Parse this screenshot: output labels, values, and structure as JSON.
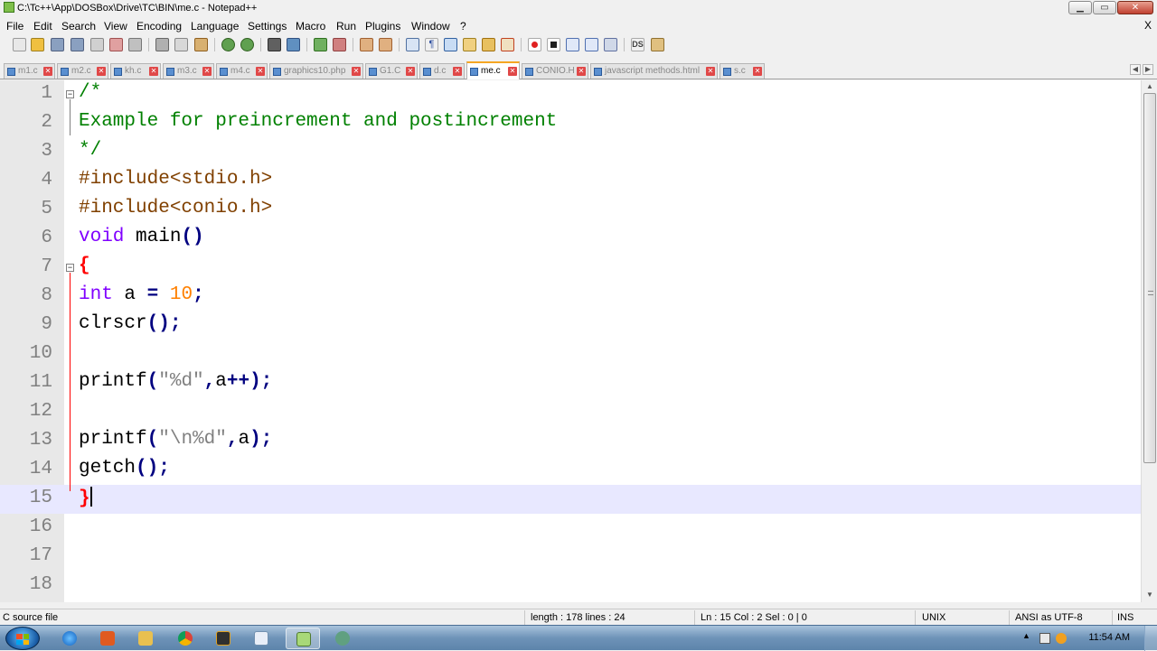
{
  "window": {
    "title": "C:\\Tc++\\App\\DOSBox\\Drive\\TC\\BIN\\me.c - Notepad++",
    "min_label": "▁",
    "max_label": "▭",
    "close_label": "✕"
  },
  "menu": {
    "items": [
      "File",
      "Edit",
      "Search",
      "View",
      "Encoding",
      "Language",
      "Settings",
      "Macro",
      "Run",
      "Plugins",
      "Window",
      "?"
    ],
    "close_label": "X"
  },
  "tabs": [
    {
      "label": "m1.c",
      "active": false
    },
    {
      "label": "m2.c",
      "active": false
    },
    {
      "label": "kh.c",
      "active": false
    },
    {
      "label": "m3.c",
      "active": false
    },
    {
      "label": "m4.c",
      "active": false
    },
    {
      "label": "graphics10.php",
      "active": false
    },
    {
      "label": "G1.C",
      "active": false
    },
    {
      "label": "d.c",
      "active": false
    },
    {
      "label": "me.c",
      "active": true
    },
    {
      "label": "CONIO.H",
      "active": false
    },
    {
      "label": "javascript methods.html",
      "active": false
    },
    {
      "label": "s.c",
      "active": false
    }
  ],
  "tab_close_label": "✕",
  "editor": {
    "current_line": 15,
    "lines": [
      {
        "n": "1",
        "tokens": [
          {
            "t": "/*",
            "c": "comment"
          }
        ]
      },
      {
        "n": "2",
        "tokens": [
          {
            "t": "Example for preincrement and postincrement",
            "c": "comment"
          }
        ]
      },
      {
        "n": "3",
        "tokens": [
          {
            "t": "*/",
            "c": "comment"
          }
        ]
      },
      {
        "n": "4",
        "tokens": [
          {
            "t": "#include<stdio.h>",
            "c": "pre"
          }
        ]
      },
      {
        "n": "5",
        "tokens": [
          {
            "t": "#include<conio.h>",
            "c": "pre"
          }
        ]
      },
      {
        "n": "6",
        "tokens": [
          {
            "t": "void",
            "c": "kw"
          },
          {
            "t": " main",
            "c": "plain"
          },
          {
            "t": "()",
            "c": "op"
          }
        ]
      },
      {
        "n": "7",
        "tokens": [
          {
            "t": "{",
            "c": "brace"
          }
        ]
      },
      {
        "n": "8",
        "tokens": [
          {
            "t": "int",
            "c": "kw"
          },
          {
            "t": " a ",
            "c": "plain"
          },
          {
            "t": "=",
            "c": "op"
          },
          {
            "t": " ",
            "c": "plain"
          },
          {
            "t": "10",
            "c": "num"
          },
          {
            "t": ";",
            "c": "op"
          }
        ]
      },
      {
        "n": "9",
        "tokens": [
          {
            "t": "clrscr",
            "c": "plain"
          },
          {
            "t": "();",
            "c": "op"
          }
        ]
      },
      {
        "n": "10",
        "tokens": []
      },
      {
        "n": "11",
        "tokens": [
          {
            "t": "printf",
            "c": "plain"
          },
          {
            "t": "(",
            "c": "op"
          },
          {
            "t": "\"%d\"",
            "c": "str"
          },
          {
            "t": ",",
            "c": "op"
          },
          {
            "t": "a",
            "c": "plain"
          },
          {
            "t": "++);",
            "c": "op"
          }
        ]
      },
      {
        "n": "12",
        "tokens": []
      },
      {
        "n": "13",
        "tokens": [
          {
            "t": "printf",
            "c": "plain"
          },
          {
            "t": "(",
            "c": "op"
          },
          {
            "t": "\"\\n%d\"",
            "c": "str"
          },
          {
            "t": ",",
            "c": "op"
          },
          {
            "t": "a",
            "c": "plain"
          },
          {
            "t": ");",
            "c": "op"
          }
        ]
      },
      {
        "n": "14",
        "tokens": [
          {
            "t": "getch",
            "c": "plain"
          },
          {
            "t": "();",
            "c": "op"
          }
        ]
      },
      {
        "n": "15",
        "tokens": [
          {
            "t": "}",
            "c": "brace"
          }
        ]
      },
      {
        "n": "16",
        "tokens": []
      },
      {
        "n": "17",
        "tokens": []
      },
      {
        "n": "18",
        "tokens": []
      }
    ]
  },
  "status": {
    "file_type": "C source file",
    "length_lines": "length : 178    lines : 24",
    "position": "Ln : 15    Col : 2    Sel : 0 | 0",
    "eol": "UNIX",
    "encoding": "ANSI as UTF-8",
    "mode": "INS"
  },
  "taskbar": {
    "clock": "11:54 AM",
    "tray_arrow": "▲"
  },
  "colors": {
    "comment": "#008000",
    "keyword": "#8000ff",
    "preprocessor": "#804000",
    "number": "#ff8000",
    "operator": "#000080",
    "string": "#808080",
    "brace": "#ff0000",
    "current_line": "#e8e8ff",
    "active_tab_accent": "#f5a623"
  }
}
